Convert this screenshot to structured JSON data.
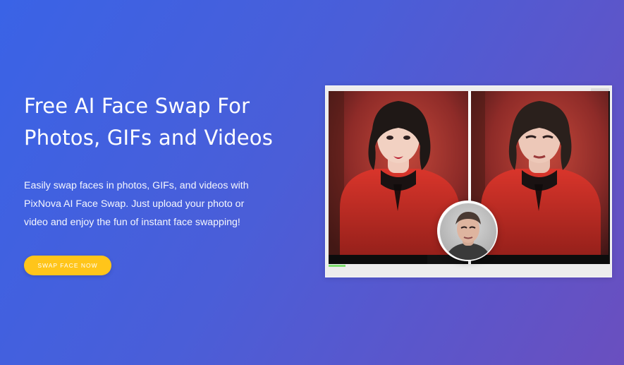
{
  "hero": {
    "headline_line1": "Free AI Face Swap For",
    "headline_line2": "Photos, GIFs and Videos",
    "description": "Easily swap faces in photos, GIFs, and videos with PixNova AI Face Swap. Just upload your photo or video and enjoy the fun of instant face swapping!",
    "cta_label": "SWAP FACE NOW"
  },
  "colors": {
    "background_start": "#3a63e6",
    "background_end": "#6a4fbf",
    "cta_bg": "#ffc51a",
    "text": "#ffffff"
  },
  "preview": {
    "icons": {
      "original_photo": "woman-portrait-image",
      "swapped_photo": "face-swapped-portrait-image",
      "source_face": "male-face-thumbnail"
    }
  }
}
